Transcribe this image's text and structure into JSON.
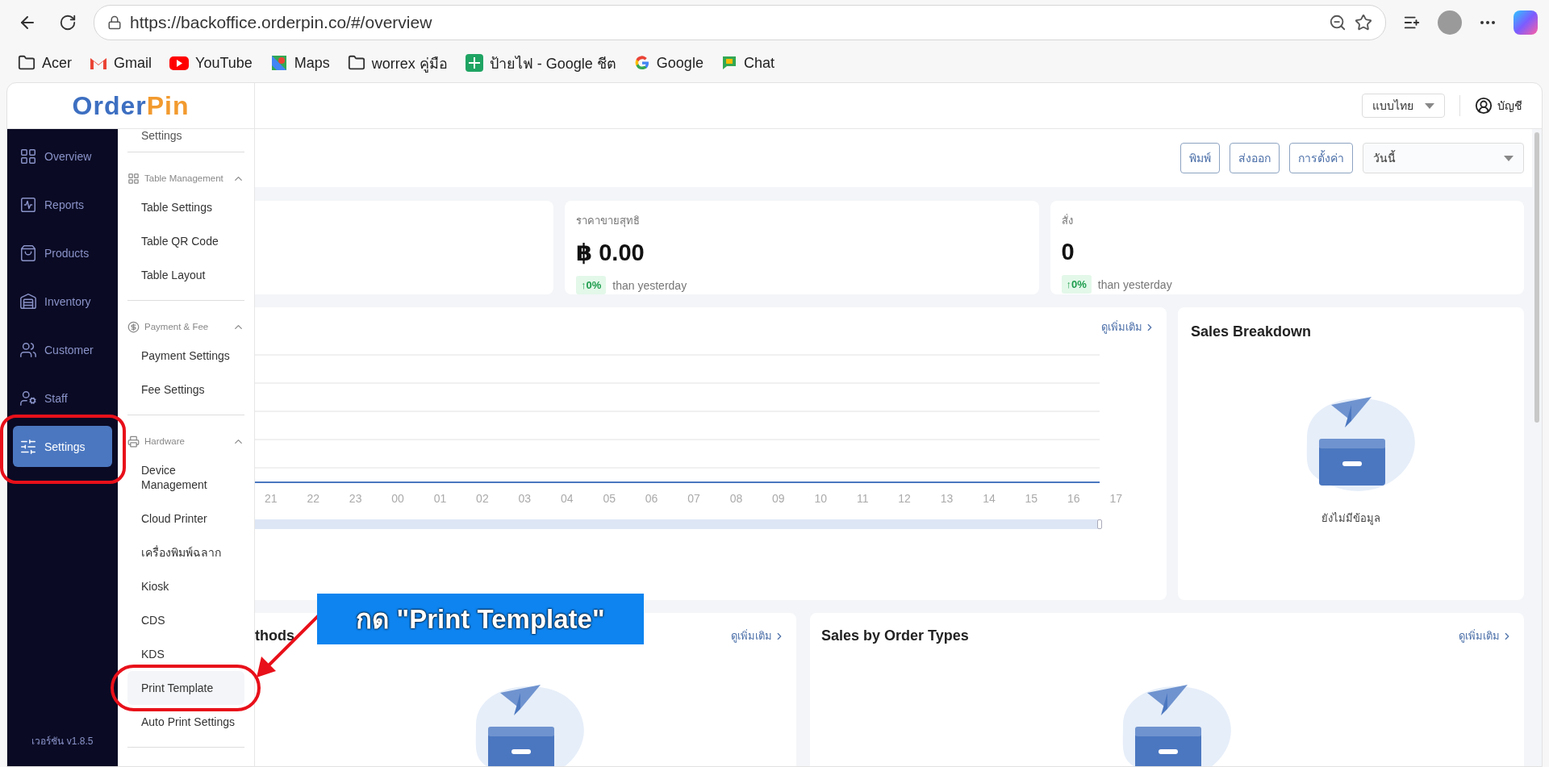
{
  "browser": {
    "url": "https://backoffice.orderpin.co/#/overview",
    "bookmarks": [
      {
        "label": "Acer",
        "kind": "folder"
      },
      {
        "label": "Gmail",
        "kind": "gmail"
      },
      {
        "label": "YouTube",
        "kind": "youtube"
      },
      {
        "label": "Maps",
        "kind": "maps"
      },
      {
        "label": "worrex คู่มือ",
        "kind": "folder"
      },
      {
        "label": "ป้ายไฟ - Google ชีต",
        "kind": "sheets"
      },
      {
        "label": "Google",
        "kind": "google"
      },
      {
        "label": "Chat",
        "kind": "chat"
      }
    ]
  },
  "header": {
    "logo_first": "Order",
    "logo_second": "Pin",
    "language": "แบบไทย",
    "account": "บัญชี"
  },
  "sidebar": {
    "items": [
      {
        "label": "Overview",
        "selected": false
      },
      {
        "label": "Reports",
        "selected": false
      },
      {
        "label": "Products",
        "selected": false
      },
      {
        "label": "Inventory",
        "selected": false
      },
      {
        "label": "Customer",
        "selected": false
      },
      {
        "label": "Staff",
        "selected": false
      },
      {
        "label": "Settings",
        "selected": true
      }
    ],
    "version": "เวอร์ชัน v1.8.5"
  },
  "submenu": {
    "top_item": "Settings",
    "groups": [
      {
        "title": "Table Management",
        "expanded": true,
        "items": [
          {
            "label": "Table Settings",
            "selected": false
          },
          {
            "label": "Table QR Code",
            "selected": false
          },
          {
            "label": "Table Layout",
            "selected": false
          }
        ]
      },
      {
        "title": "Payment & Fee",
        "expanded": true,
        "items": [
          {
            "label": "Payment Settings",
            "selected": false
          },
          {
            "label": "Fee Settings",
            "selected": false
          }
        ]
      },
      {
        "title": "Hardware",
        "expanded": true,
        "items": [
          {
            "label": "Device Management",
            "selected": false
          },
          {
            "label": "Cloud Printer",
            "selected": false
          },
          {
            "label": "เครื่องพิมพ์ฉลาก",
            "selected": false
          },
          {
            "label": "Kiosk",
            "selected": false
          },
          {
            "label": "CDS",
            "selected": false
          },
          {
            "label": "KDS",
            "selected": false
          },
          {
            "label": "Print Template",
            "selected": true
          },
          {
            "label": "Auto Print Settings",
            "selected": false
          }
        ]
      }
    ]
  },
  "toolbar": {
    "buttons": [
      "พิมพ์",
      "ส่งออก",
      "การตั้งค่า"
    ],
    "date_range": "วันนี้"
  },
  "stats": [
    {
      "label": "ราคาขายสุทธิ",
      "value": "฿ 0.00",
      "change": "↑0%",
      "note": "than yesterday"
    },
    {
      "label": "สั่ง",
      "value": "0",
      "change": "↑0%",
      "note": "than yesterday"
    }
  ],
  "sales_chart": {
    "more_link": "ดูเพิ่มเติม",
    "zoom": {
      "level": 1
    },
    "hours": [
      "21",
      "22",
      "23",
      "00",
      "01",
      "02",
      "03",
      "04",
      "05",
      "06",
      "07",
      "08",
      "09",
      "10",
      "11",
      "12",
      "13",
      "14",
      "15",
      "16",
      "17"
    ]
  },
  "sales_breakdown": {
    "title": "Sales Breakdown",
    "empty_text": "ยังไม่มีข้อมูล"
  },
  "bottom_cards": [
    {
      "title": "thods",
      "more_link": "ดูเพิ่มเติม"
    },
    {
      "title": "Sales by Order Types",
      "more_link": "ดูเพิ่มเติม"
    }
  ],
  "annotation": {
    "caption": "กด \"Print Template\""
  }
}
